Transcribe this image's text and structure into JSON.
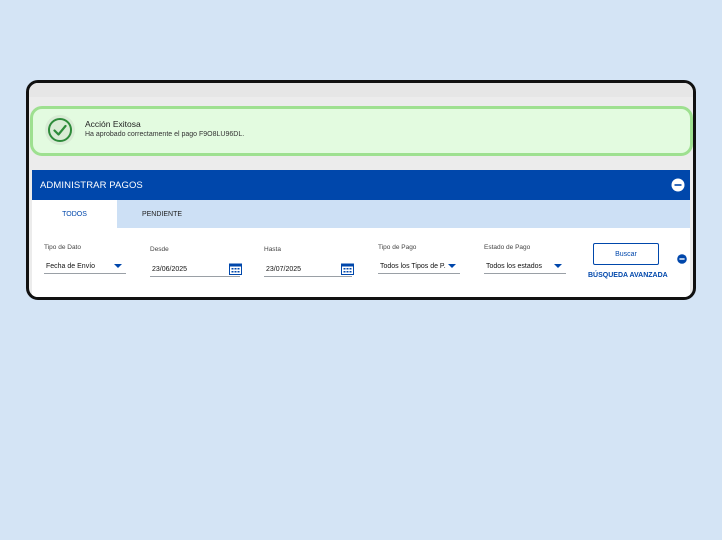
{
  "alert": {
    "title": "Acción Exitosa",
    "message": "Ha aprobado correctamente el pago F9O8LU96DL.",
    "icon": "check-circle-icon"
  },
  "panel": {
    "title": "ADMINISTRAR PAGOS",
    "collapse_icon": "minus-circle-icon"
  },
  "tabs": [
    {
      "label": "TODOS",
      "active": true
    },
    {
      "label": "PENDIENTE",
      "active": false
    }
  ],
  "filters": {
    "tipo_dato": {
      "label": "Tipo de Dato",
      "value": "Fecha de Envío"
    },
    "desde": {
      "label": "Desde",
      "value": "23/06/2025"
    },
    "hasta": {
      "label": "Hasta",
      "value": "23/07/2025"
    },
    "tipo_pago": {
      "label": "Tipo de Pago",
      "value": "Todos los Tipos de P..."
    },
    "estado_pago": {
      "label": "Estado de Pago",
      "value": "Todos los estados"
    }
  },
  "actions": {
    "search_label": "Buscar",
    "advanced_label": "BÚSQUEDA AVANZADA"
  },
  "colors": {
    "brand": "#0047ab",
    "success_bg": "#e3fbe0",
    "success_border": "#9ee090",
    "page_bg": "#d4e4f5"
  }
}
